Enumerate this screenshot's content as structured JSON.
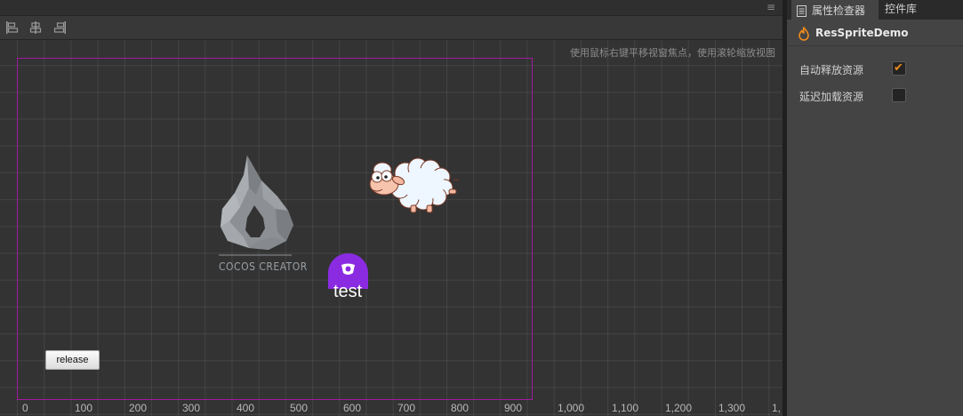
{
  "scene": {
    "hint_text": "使用鼠标右键平移视窗焦点，使用滚轮缩放视图",
    "menu_icon": "hamburger-icon",
    "toolbar": [
      "align-left-icon",
      "align-center-icon",
      "align-right-icon"
    ],
    "logo_text": "COCOS CREATOR",
    "test_label": "test",
    "release_button": "release",
    "ruler": [
      "0",
      "100",
      "200",
      "300",
      "400",
      "500",
      "600",
      "700",
      "800",
      "900",
      "1,000",
      "1,100",
      "1,200",
      "1,300",
      "1,"
    ]
  },
  "inspector": {
    "tabs": [
      {
        "label": "属性检查器",
        "icon": "document-icon",
        "active": true
      },
      {
        "label": "控件库",
        "active": false
      }
    ],
    "node": {
      "name": "ResSpriteDemo",
      "icon": "flame-icon"
    },
    "properties": [
      {
        "label": "自动释放资源",
        "checked": true
      },
      {
        "label": "延迟加载资源",
        "checked": false
      }
    ]
  },
  "colors": {
    "canvas_frame": "#a01aa0",
    "accent_orange": "#f08a1c",
    "test_icon": "#8a2be2"
  }
}
